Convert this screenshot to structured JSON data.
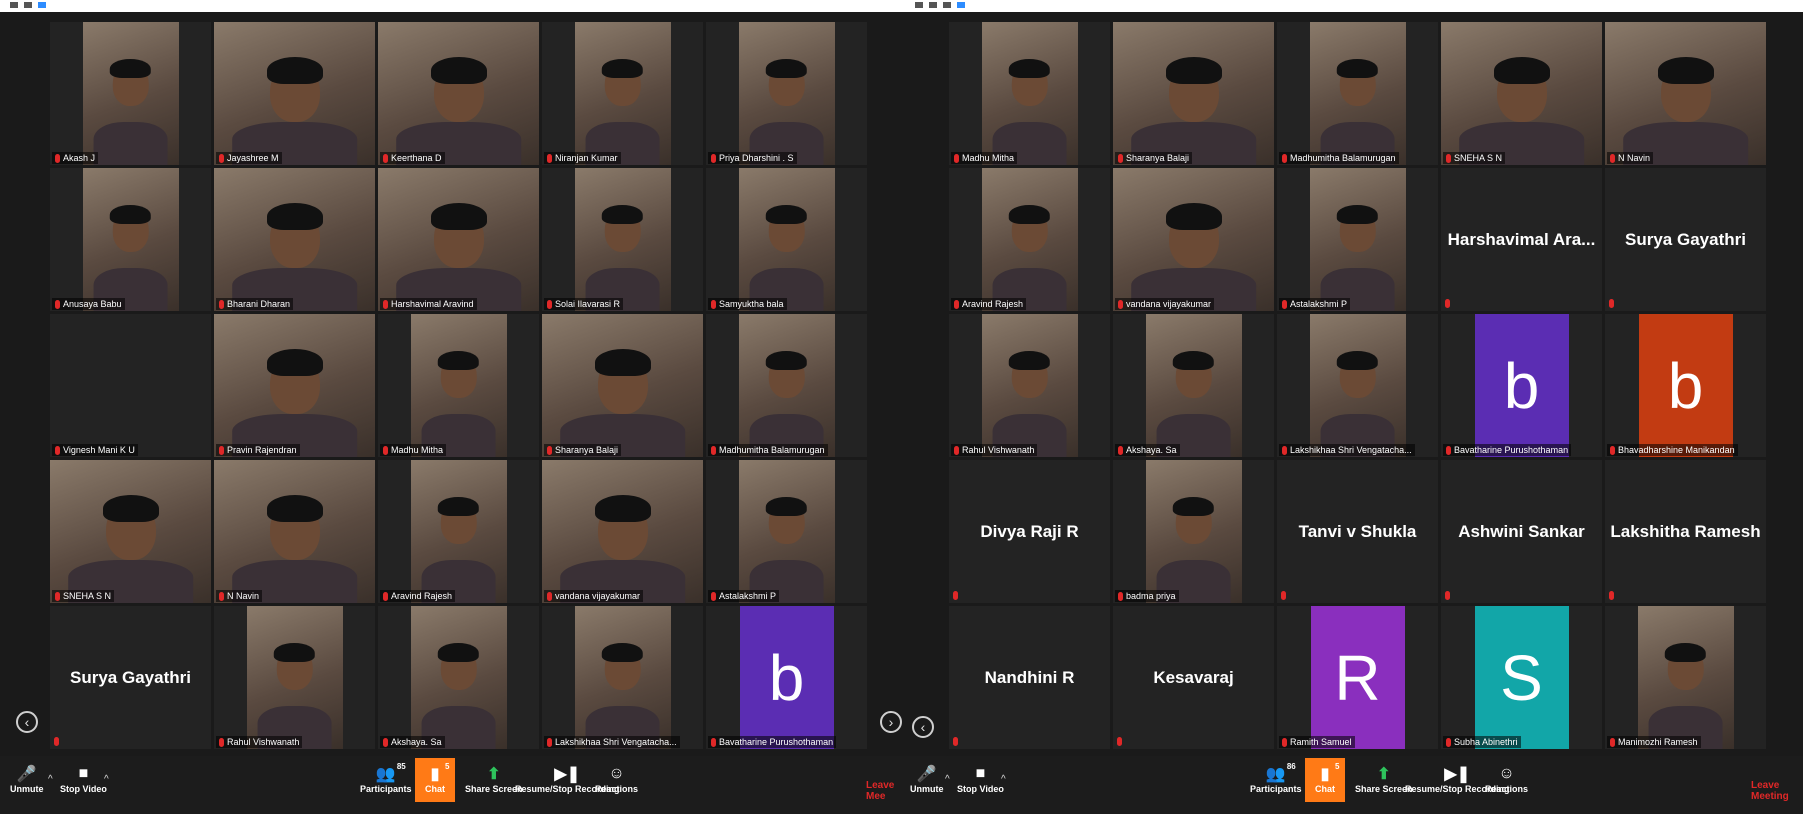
{
  "left": {
    "tiles": [
      {
        "label": "Akash J",
        "type": "video",
        "wide": false
      },
      {
        "label": "Jayashree M",
        "type": "video",
        "wide": true
      },
      {
        "label": "Keerthana D",
        "type": "video",
        "wide": true
      },
      {
        "label": "Niranjan Kumar",
        "type": "video",
        "wide": false
      },
      {
        "label": "Priya Dharshini . S",
        "type": "video",
        "wide": false
      },
      {
        "label": "Anusaya Babu",
        "type": "video",
        "wide": false
      },
      {
        "label": "Bharani Dharan",
        "type": "video",
        "wide": true
      },
      {
        "label": "Harshavimal Aravind",
        "type": "video",
        "wide": true
      },
      {
        "label": "Solai Ilavarasi R",
        "type": "video",
        "wide": false
      },
      {
        "label": "Samyuktha bala",
        "type": "video",
        "wide": false
      },
      {
        "label": "Vignesh Mani K U",
        "type": "name",
        "name": ""
      },
      {
        "label": "Pravin Rajendran",
        "type": "video",
        "wide": true
      },
      {
        "label": "Madhu Mitha",
        "type": "video",
        "wide": false
      },
      {
        "label": "Sharanya Balaji",
        "type": "video",
        "wide": true
      },
      {
        "label": "Madhumitha Balamurugan",
        "type": "video",
        "wide": false
      },
      {
        "label": "SNEHA S N",
        "type": "video",
        "wide": true
      },
      {
        "label": "N Navin",
        "type": "video",
        "wide": true
      },
      {
        "label": "Aravind Rajesh",
        "type": "video",
        "wide": false
      },
      {
        "label": "vandana vijayakumar",
        "type": "video",
        "wide": true
      },
      {
        "label": "Astalakshmi P",
        "type": "video",
        "wide": false
      },
      {
        "label": "",
        "type": "name",
        "name": "Surya Gayathri"
      },
      {
        "label": "Rahul Vishwanath",
        "type": "video",
        "wide": false
      },
      {
        "label": "Akshaya. Sa",
        "type": "video",
        "wide": false
      },
      {
        "label": "Lakshikhaa Shri Vengatacha...",
        "type": "video",
        "wide": false
      },
      {
        "label": "Bavatharine Purushothaman",
        "type": "avatar",
        "letter": "b",
        "color": "#5b2db3"
      }
    ],
    "toolbar": {
      "unmute": "Unmute",
      "stop_video": "Stop Video",
      "participants": "Participants",
      "participants_count": "85",
      "chat": "Chat",
      "chat_count": "5",
      "share": "Share Screen",
      "recording": "Resume/Stop Recording",
      "reactions": "Reactions",
      "leave": "Leave Mee"
    }
  },
  "right": {
    "tiles": [
      {
        "label": "Madhu Mitha",
        "type": "video",
        "wide": false
      },
      {
        "label": "Sharanya Balaji",
        "type": "video",
        "wide": true
      },
      {
        "label": "Madhumitha Balamurugan",
        "type": "video",
        "wide": false
      },
      {
        "label": "SNEHA S N",
        "type": "video",
        "wide": true
      },
      {
        "label": "N Navin",
        "type": "video",
        "wide": true
      },
      {
        "label": "Aravind Rajesh",
        "type": "video",
        "wide": false
      },
      {
        "label": "vandana vijayakumar",
        "type": "video",
        "wide": true
      },
      {
        "label": "Astalakshmi P",
        "type": "video",
        "wide": false
      },
      {
        "label": "",
        "type": "name",
        "name": "Harshavimal Ara..."
      },
      {
        "label": "",
        "type": "name",
        "name": "Surya Gayathri"
      },
      {
        "label": "Rahul Vishwanath",
        "type": "video",
        "wide": false
      },
      {
        "label": "Akshaya. Sa",
        "type": "video",
        "wide": false
      },
      {
        "label": "Lakshikhaa Shri Vengatacha...",
        "type": "video",
        "wide": false
      },
      {
        "label": "Bavatharine Purushothaman",
        "type": "avatar",
        "letter": "b",
        "color": "#5b2db3"
      },
      {
        "label": "Bhavadharshine Manikandan",
        "type": "avatar",
        "letter": "b",
        "color": "#c23b12"
      },
      {
        "label": "",
        "type": "name",
        "name": "Divya Raji R"
      },
      {
        "label": "badma priya",
        "type": "video",
        "wide": false
      },
      {
        "label": "",
        "type": "name",
        "name": "Tanvi v Shukla"
      },
      {
        "label": "",
        "type": "name",
        "name": "Ashwini Sankar"
      },
      {
        "label": "",
        "type": "name",
        "name": "Lakshitha Ramesh"
      },
      {
        "label": "",
        "type": "name",
        "name": "Nandhini R"
      },
      {
        "label": "",
        "type": "name",
        "name": "Kesavaraj"
      },
      {
        "label": "Ramith Samuel",
        "type": "avatar",
        "letter": "R",
        "color": "#8a2fbe"
      },
      {
        "label": "Subha Abinethri",
        "type": "avatar",
        "letter": "S",
        "color": "#12a6a8"
      },
      {
        "label": "Manimozhi Ramesh",
        "type": "video",
        "wide": false
      }
    ],
    "toolbar": {
      "unmute": "Unmute",
      "stop_video": "Stop Video",
      "participants": "Participants",
      "participants_count": "86",
      "chat": "Chat",
      "chat_count": "5",
      "share": "Share Screen",
      "recording": "Resume/Stop Recording",
      "reactions": "Reactions",
      "leave": "Leave Meeting"
    }
  },
  "icons": {
    "mic": "mic-off-icon",
    "video": "video-camera-icon",
    "participants": "people-icon",
    "chat": "chat-bubble-icon",
    "share": "share-screen-icon",
    "record": "record-icon",
    "reactions": "emoji-icon",
    "arrow_left": "chevron-left-icon",
    "arrow_right": "chevron-right-icon"
  }
}
